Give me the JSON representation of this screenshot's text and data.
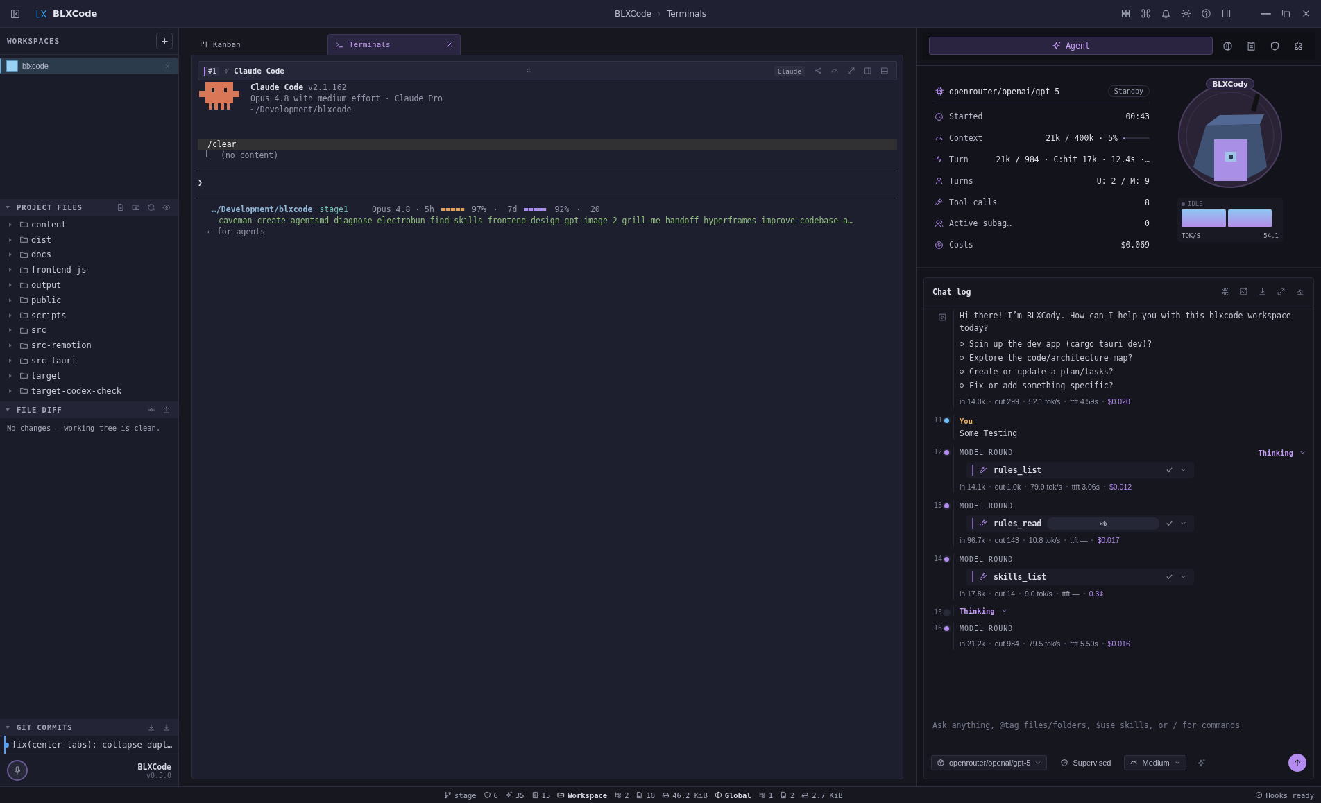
{
  "titlebar": {
    "app_name": "BLXCode",
    "breadcrumb": [
      "BLXCode",
      "Terminals"
    ]
  },
  "workspaces": {
    "title": "WORKSPACES",
    "items": [
      {
        "name": "blxcode",
        "selected": true
      }
    ]
  },
  "project_files": {
    "title": "PROJECT FILES",
    "expanded": true,
    "items": [
      {
        "name": "content"
      },
      {
        "name": "dist"
      },
      {
        "name": "docs"
      },
      {
        "name": "frontend-js"
      },
      {
        "name": "output"
      },
      {
        "name": "public"
      },
      {
        "name": "scripts"
      },
      {
        "name": "src"
      },
      {
        "name": "src-remotion"
      },
      {
        "name": "src-tauri"
      },
      {
        "name": "target"
      },
      {
        "name": "target-codex-check"
      }
    ]
  },
  "file_diff": {
    "title": "FILE DIFF",
    "expanded": true,
    "message": "No changes — working tree is clean."
  },
  "git_commits": {
    "title": "GIT COMMITS",
    "expanded": true,
    "items": [
      {
        "message": "fix(center-tabs): collapse dupl…"
      }
    ]
  },
  "footer": {
    "app_name": "BLXCode",
    "version": "v0.5.0"
  },
  "tabs": [
    {
      "label": "Kanban",
      "kind": "kanban",
      "selected": false
    },
    {
      "label": "Terminals",
      "kind": "terminal",
      "selected": true
    }
  ],
  "terminal": {
    "index": "#1",
    "title": "Claude Code",
    "badge": "Claude",
    "banner": {
      "name": "Claude Code",
      "version": "v2.1.162",
      "model_line": "Opus 4.8 with medium effort · Claude Pro",
      "path": "~/Development/blxcode"
    },
    "command": "/clear",
    "output": "(no content)",
    "prompt": "❯",
    "status": {
      "path": "…/Development/blxcode",
      "branch": "stage1",
      "model": "Opus 4.8 · 5h",
      "usage_5h": {
        "level": 0.97,
        "text": "97%"
      },
      "mid": "·  7d",
      "usage_7d": {
        "level": 0.92,
        "text": "92%"
      },
      "tail": "·  20"
    },
    "skills": "caveman create-agentsmd diagnose electrobun find-skills frontend-design gpt-image-2 grill-me handoff hyperframes improve-codebase-a…",
    "hint": "← for agents"
  },
  "agent_tabs": [
    {
      "label": "Agent",
      "selected": true
    }
  ],
  "agent": {
    "model": "openrouter/openai/gpt-5",
    "status": "Standby",
    "stats": [
      {
        "kind": "clock",
        "label": "Started",
        "value": "00:43"
      },
      {
        "kind": "gauge",
        "label": "Context",
        "value": "21k / 400k · 5%",
        "level": 0.05
      },
      {
        "kind": "pulse",
        "label": "Turn",
        "value": "21k / 984 · C:hit 17k · 12.4s ·…"
      },
      {
        "kind": "user",
        "label": "Turns",
        "value": "U: 2 / M: 9"
      },
      {
        "kind": "wrench",
        "label": "Tool calls",
        "value": "8"
      },
      {
        "kind": "users",
        "label": "Active subag…",
        "value": "0"
      },
      {
        "kind": "dollar",
        "label": "Costs",
        "value": "$0.069"
      }
    ],
    "avatar_name": "BLXCody",
    "state": "IDLE",
    "rate_label": "TOK/S",
    "rate_value": "54.1"
  },
  "chat_log": {
    "title": "Chat log",
    "messages": [
      {
        "kind": "assistant",
        "text": "Hi there! I’m BLXCody. How can I help you with this blxcode workspace today?",
        "bullets": [
          "Spin up the dev app (cargo tauri dev)?",
          "Explore the code/architecture map?",
          "Create or update a plan/tasks?",
          "Fix or add something specific?"
        ],
        "metrics": [
          "in 14.0k",
          "out 299",
          "52.1 tok/s",
          "ttft 4.59s"
        ],
        "cost": "$0.020"
      },
      {
        "kind": "user",
        "number": "11",
        "author": "You",
        "text": "Some Testing"
      },
      {
        "kind": "round",
        "number": "12",
        "label": "MODEL ROUND",
        "thinking": "Thinking",
        "tools": [
          {
            "name": "rules_list",
            "done": true
          }
        ],
        "metrics": [
          "in 14.1k",
          "out 1.0k",
          "79.9 tok/s",
          "ttft 3.06s"
        ],
        "cost": "$0.012"
      },
      {
        "kind": "round",
        "number": "13",
        "label": "MODEL ROUND",
        "tools": [
          {
            "name": "rules_read",
            "count": "×6",
            "done": true
          }
        ],
        "metrics": [
          "in 96.7k",
          "out 143",
          "10.8 tok/s",
          "ttft —"
        ],
        "cost": "$0.017"
      },
      {
        "kind": "round",
        "number": "14",
        "label": "MODEL ROUND",
        "tools": [
          {
            "name": "skills_list",
            "done": true
          }
        ],
        "metrics": [
          "in 17.8k",
          "out 14",
          "9.0 tok/s",
          "ttft —"
        ],
        "cost": "0.3¢"
      },
      {
        "kind": "thinking",
        "number": "15",
        "label": "Thinking"
      },
      {
        "kind": "round",
        "number": "16",
        "label": "MODEL ROUND",
        "metrics": [
          "in 21.2k",
          "out 984",
          "79.5 tok/s",
          "ttft 5.50s"
        ],
        "cost": "$0.016"
      }
    ]
  },
  "composer": {
    "placeholder": "Ask anything, @tag files/folders, $use skills, or / for commands",
    "model": "openrouter/openai/gpt-5",
    "mode": "Supervised",
    "effort": "Medium"
  },
  "status_bar": {
    "items": [
      {
        "kind": "branch",
        "text": "stage"
      },
      {
        "kind": "shield",
        "text": "6"
      },
      {
        "kind": "sparkle",
        "text": "35"
      },
      {
        "kind": "clipboard",
        "text": "15"
      },
      {
        "kind": "scope",
        "text": "Workspace"
      },
      {
        "kind": "tree",
        "text": "2"
      },
      {
        "kind": "file",
        "text": "10"
      },
      {
        "kind": "drive",
        "text": "46.2 KiB"
      },
      {
        "kind": "globe",
        "text": "Global"
      },
      {
        "kind": "tree",
        "text": "1"
      },
      {
        "kind": "file",
        "text": "2"
      },
      {
        "kind": "drive",
        "text": "2.7 KiB"
      }
    ],
    "hooks": "Hooks ready"
  }
}
